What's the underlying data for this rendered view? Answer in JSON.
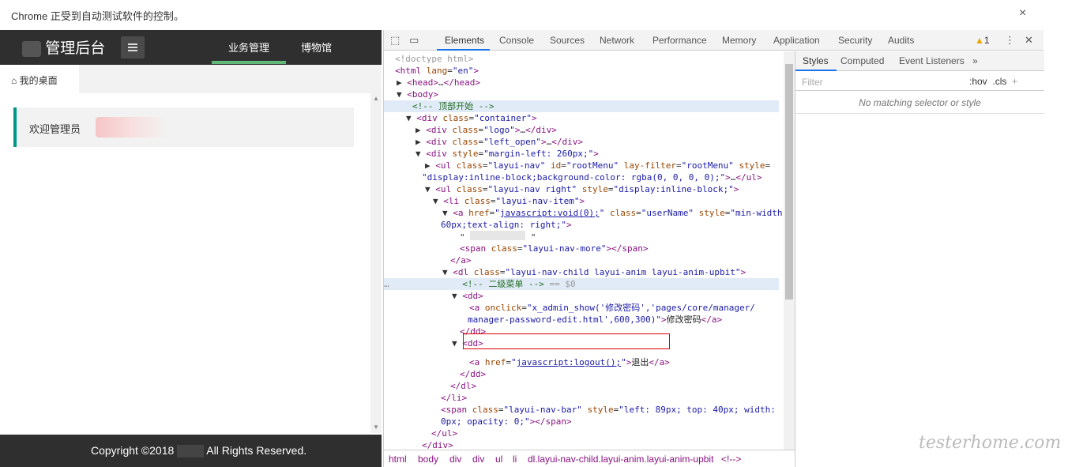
{
  "infobar": {
    "message": "Chrome 正受到自动测试软件的控制。",
    "close": "×"
  },
  "app": {
    "logo_text": "管理后台",
    "nav": [
      {
        "label": "业务管理"
      },
      {
        "label": "博物馆"
      }
    ],
    "tab_home": "我的桌面",
    "welcome": "欢迎管理员",
    "footer_left": "Copyright ©2018",
    "footer_right": "All Rights Reserved."
  },
  "devtools": {
    "tabs": [
      "Elements",
      "Console",
      "Sources",
      "Network",
      "Performance",
      "Memory",
      "Application",
      "Security",
      "Audits"
    ],
    "warning_count": "1",
    "styles_tabs": [
      "Styles",
      "Computed",
      "Event Listeners",
      "»"
    ],
    "filter_placeholder": "Filter",
    "hov": ":hov",
    "cls": ".cls",
    "no_match": "No matching selector or style",
    "breadcrumb": [
      "html",
      "body",
      "div",
      "div",
      "ul",
      "li",
      "dl.layui-nav-child.layui-anim.layui-anim-upbit",
      "<!-->"
    ]
  },
  "watermark": "testerhome.com"
}
